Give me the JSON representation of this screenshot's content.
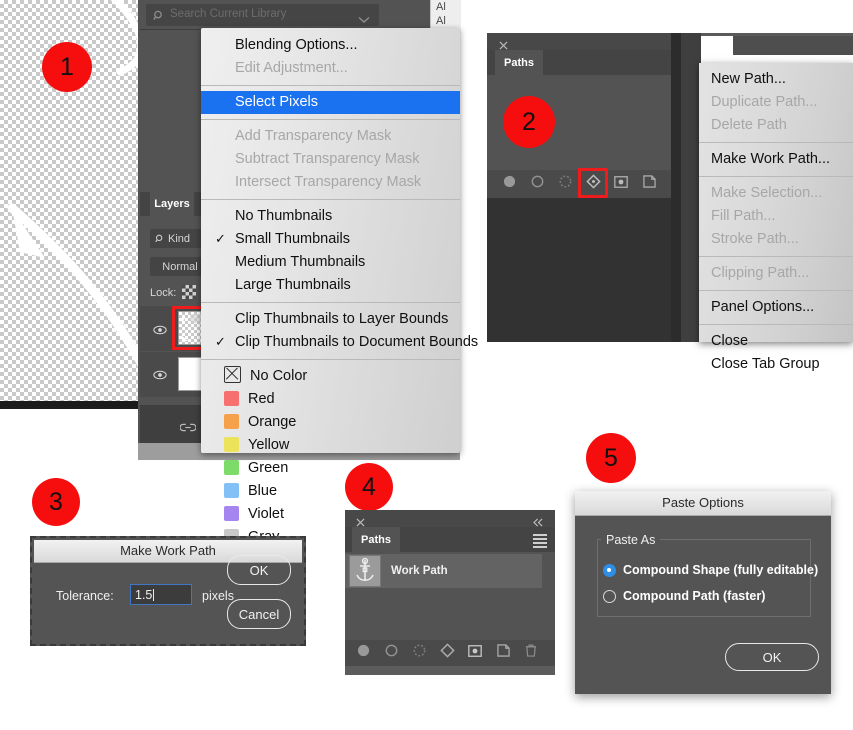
{
  "markers": [
    {
      "n": "1"
    },
    {
      "n": "2"
    },
    {
      "n": "3"
    },
    {
      "n": "4"
    },
    {
      "n": "5"
    }
  ],
  "panel1": {
    "search_placeholder": "Search Current Library",
    "layers_tab": "Layers",
    "kind_filter": "Kind",
    "blend_mode": "Normal",
    "lock_label": "Lock:",
    "right_edge_text_1": "Al",
    "right_edge_text_2": "Al",
    "menu": {
      "groups": [
        {
          "items": [
            {
              "label": "Blending Options...",
              "state": "normal",
              "check": false
            },
            {
              "label": "Edit Adjustment...",
              "state": "disabled",
              "check": false
            }
          ]
        },
        {
          "items": [
            {
              "label": "Select Pixels",
              "state": "selected",
              "check": false
            }
          ]
        },
        {
          "items": [
            {
              "label": "Add Transparency Mask",
              "state": "disabled",
              "check": false
            },
            {
              "label": "Subtract Transparency Mask",
              "state": "disabled",
              "check": false
            },
            {
              "label": "Intersect Transparency Mask",
              "state": "disabled",
              "check": false
            }
          ]
        },
        {
          "items": [
            {
              "label": "No Thumbnails",
              "state": "normal",
              "check": false
            },
            {
              "label": "Small Thumbnails",
              "state": "normal",
              "check": true
            },
            {
              "label": "Medium Thumbnails",
              "state": "normal",
              "check": false
            },
            {
              "label": "Large Thumbnails",
              "state": "normal",
              "check": false
            }
          ]
        },
        {
          "items": [
            {
              "label": "Clip Thumbnails to Layer Bounds",
              "state": "normal",
              "check": false
            },
            {
              "label": "Clip Thumbnails to Document Bounds",
              "state": "normal",
              "check": true
            }
          ]
        }
      ],
      "colors": [
        {
          "label": "No Color",
          "hex": "none"
        },
        {
          "label": "Red",
          "hex": "#f76f6f"
        },
        {
          "label": "Orange",
          "hex": "#f5a04a"
        },
        {
          "label": "Yellow",
          "hex": "#ece35a"
        },
        {
          "label": "Green",
          "hex": "#7ddb6a"
        },
        {
          "label": "Blue",
          "hex": "#82c0f5"
        },
        {
          "label": "Violet",
          "hex": "#a585ef"
        },
        {
          "label": "Gray",
          "hex": "#c9c9c9"
        }
      ]
    }
  },
  "panel2": {
    "tab_label": "Paths",
    "close_icon": "close-icon",
    "collapse_icon": "double-chevron-left-icon",
    "menu_icon": "panel-menu-icon",
    "footer_icons": [
      "fill-path-icon",
      "stroke-path-icon",
      "load-path-as-selection-icon",
      "make-work-path-icon",
      "add-layer-mask-icon",
      "new-path-icon",
      "delete-path-icon"
    ],
    "menu": [
      {
        "label": "New Path...",
        "state": "normal"
      },
      {
        "label": "Duplicate Path...",
        "state": "disabled"
      },
      {
        "label": "Delete Path",
        "state": "disabled"
      },
      {
        "sep": true
      },
      {
        "label": "Make Work Path...",
        "state": "normal"
      },
      {
        "sep": true
      },
      {
        "label": "Make Selection...",
        "state": "disabled"
      },
      {
        "label": "Fill Path...",
        "state": "disabled"
      },
      {
        "label": "Stroke Path...",
        "state": "disabled"
      },
      {
        "sep": true
      },
      {
        "label": "Clipping Path...",
        "state": "disabled"
      },
      {
        "sep": true
      },
      {
        "label": "Panel Options...",
        "state": "normal"
      },
      {
        "sep": true
      },
      {
        "label": "Close",
        "state": "normal"
      },
      {
        "label": "Close Tab Group",
        "state": "normal"
      }
    ]
  },
  "panel3": {
    "title": "Make Work Path",
    "tolerance_label": "Tolerance:",
    "tolerance_value": "1.5",
    "units": "pixels",
    "ok": "OK",
    "cancel": "Cancel"
  },
  "panel4": {
    "tab_label": "Paths",
    "path_name": "Work Path",
    "close_icon": "close-icon",
    "collapse_icon": "double-chevron-left-icon",
    "menu_icon": "panel-menu-icon",
    "footer_icons": [
      "fill-path-icon",
      "stroke-path-icon",
      "load-path-as-selection-icon",
      "make-work-path-icon",
      "add-layer-mask-icon",
      "new-path-icon",
      "delete-path-icon"
    ]
  },
  "panel5": {
    "title": "Paste Options",
    "group_label": "Paste As",
    "options": [
      {
        "label": "Compound Shape (fully editable)",
        "selected": true
      },
      {
        "label": "Compound Path (faster)",
        "selected": false
      }
    ],
    "ok": "OK"
  },
  "colors": {
    "marker_red": "#f60d0d",
    "highlight_red": "#ee1c1c",
    "menu_selection_blue": "#1b72f0",
    "radio_blue": "#2f8fe6",
    "panel_gray": "#535353"
  }
}
